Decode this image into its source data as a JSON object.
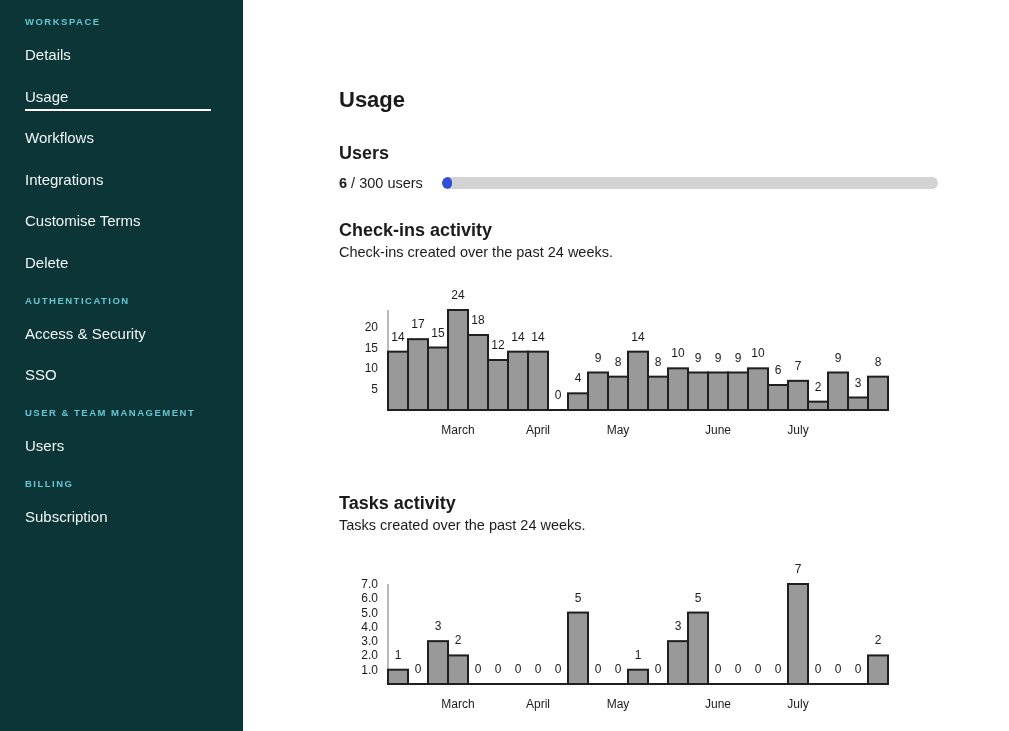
{
  "sidebar": {
    "sections": [
      {
        "heading": "WORKSPACE",
        "items": [
          {
            "label": "Details",
            "selected": false
          },
          {
            "label": "Usage",
            "selected": true
          },
          {
            "label": "Workflows",
            "selected": false
          },
          {
            "label": "Integrations",
            "selected": false
          },
          {
            "label": "Customise Terms",
            "selected": false
          },
          {
            "label": "Delete",
            "selected": false
          }
        ]
      },
      {
        "heading": "AUTHENTICATION",
        "items": [
          {
            "label": "Access & Security",
            "selected": false
          },
          {
            "label": "SSO",
            "selected": false
          }
        ]
      },
      {
        "heading": "USER & TEAM MANAGEMENT",
        "items": [
          {
            "label": "Users",
            "selected": false
          }
        ]
      },
      {
        "heading": "BILLING",
        "items": [
          {
            "label": "Subscription",
            "selected": false
          }
        ]
      }
    ]
  },
  "page": {
    "title": "Usage"
  },
  "users": {
    "heading": "Users",
    "summary": "**6** / 300 users",
    "level": 0.02
  },
  "charts": [
    {
      "heading": "Check-ins activity",
      "description": "Check-ins created over the past 24 weeks.",
      "chart_data": {
        "type": "bar",
        "categories": [
          null,
          null,
          null,
          "March",
          null,
          null,
          null,
          "April",
          null,
          null,
          null,
          "May",
          null,
          null,
          null,
          null,
          "June",
          null,
          null,
          null,
          "July",
          null,
          null,
          null,
          null
        ],
        "values": [
          14,
          17,
          15,
          24,
          18,
          12,
          14,
          14,
          0,
          4,
          9,
          8,
          14,
          8,
          10,
          9,
          9,
          9,
          10,
          6,
          7,
          2,
          9,
          3,
          8
        ],
        "ylim": [
          0,
          24
        ],
        "yticks": [
          5,
          10,
          15,
          20
        ],
        "data_labels": true
      }
    },
    {
      "heading": "Tasks activity",
      "description": "Tasks created over the past 24 weeks.",
      "chart_data": {
        "type": "bar",
        "categories": [
          null,
          null,
          null,
          "March",
          null,
          null,
          null,
          "April",
          null,
          null,
          null,
          "May",
          null,
          null,
          null,
          null,
          "June",
          null,
          null,
          null,
          "July",
          null,
          null,
          null,
          null
        ],
        "values": [
          1,
          0,
          3,
          2,
          0,
          0,
          0,
          0,
          0,
          5,
          0,
          0,
          1,
          0,
          3,
          5,
          0,
          0,
          0,
          0,
          7,
          0,
          0,
          0,
          2
        ],
        "ylim": [
          0,
          7
        ],
        "yticks": [
          {
            "value": 1,
            "label": "1.0"
          },
          {
            "value": 2,
            "label": "2.0"
          },
          {
            "value": 3,
            "label": "3.0"
          },
          {
            "value": 4,
            "label": "4.0"
          },
          {
            "value": 5,
            "label": "5.0"
          },
          {
            "value": 6,
            "label": "6.0"
          },
          {
            "value": 7,
            "label": "7.0"
          }
        ],
        "data_labels": true
      }
    }
  ]
}
